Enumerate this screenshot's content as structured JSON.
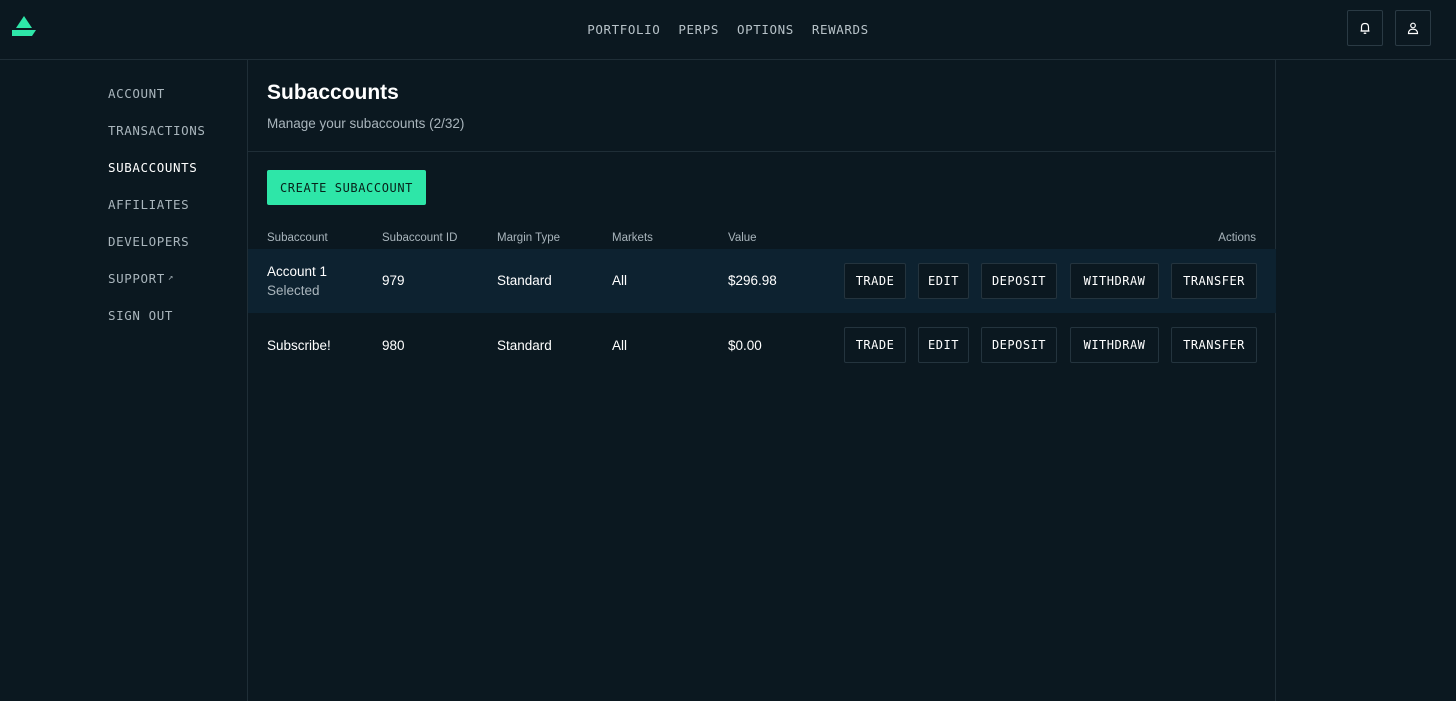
{
  "header": {
    "nav": [
      "PORTFOLIO",
      "PERPS",
      "OPTIONS",
      "REWARDS"
    ],
    "notifications_icon": "bell-icon",
    "profile_icon": "user-icon",
    "accent_color": "#2ee6a8"
  },
  "sidebar": {
    "items": [
      {
        "label": "ACCOUNT"
      },
      {
        "label": "TRANSACTIONS"
      },
      {
        "label": "SUBACCOUNTS",
        "active": true
      },
      {
        "label": "AFFILIATES"
      },
      {
        "label": "DEVELOPERS"
      },
      {
        "label": "SUPPORT",
        "external_icon": "↗"
      },
      {
        "label": "SIGN OUT"
      }
    ]
  },
  "main": {
    "title": "Subaccounts",
    "subtitle": "Manage your subaccounts (2/32)",
    "create_button": "CREATE SUBACCOUNT",
    "columns": [
      "Subaccount",
      "Subaccount ID",
      "Margin Type",
      "Markets",
      "Value",
      "Actions"
    ],
    "rows": [
      {
        "name": "Account 1",
        "status": "Selected",
        "id": "979",
        "margin_type": "Standard",
        "markets": "All",
        "value": "$296.98"
      },
      {
        "name": "Subscribe!",
        "status": "",
        "id": "980",
        "margin_type": "Standard",
        "markets": "All",
        "value": "$0.00"
      }
    ],
    "actions": [
      "TRADE",
      "EDIT",
      "DEPOSIT",
      "WITHDRAW",
      "TRANSFER"
    ]
  }
}
